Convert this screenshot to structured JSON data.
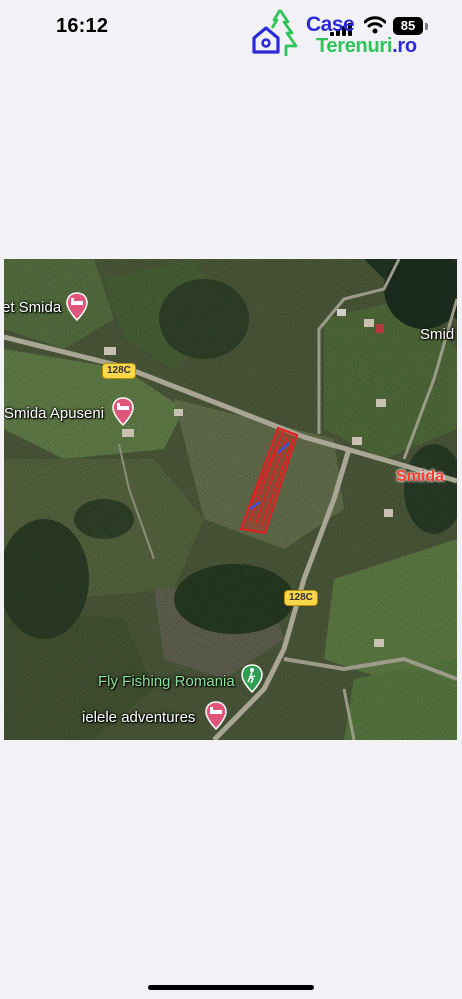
{
  "status_bar": {
    "time": "16:12",
    "battery": "85"
  },
  "logo": {
    "line1": "Case",
    "line2": "Terenuri",
    "suffix": ".ro"
  },
  "map": {
    "places": {
      "smida_top": "et Smida",
      "smida_apuseni": "Smida Apuseni",
      "smida_right": "Smid",
      "smida_village": "Smida",
      "fly_fishing": "Fly Fishing Romania",
      "ielele": "ielele adventures"
    },
    "road_shields": {
      "upper": "128C",
      "lower": "128C"
    },
    "icons": [
      "lodging-pin-icon",
      "lodging-pin-icon",
      "hiking-pin-icon",
      "lodging-pin-icon"
    ],
    "colors": {
      "parcel": "#e02020",
      "label_red": "#ff3b30",
      "label_green": "#8ee39a",
      "shield": "#f9d64a"
    }
  }
}
